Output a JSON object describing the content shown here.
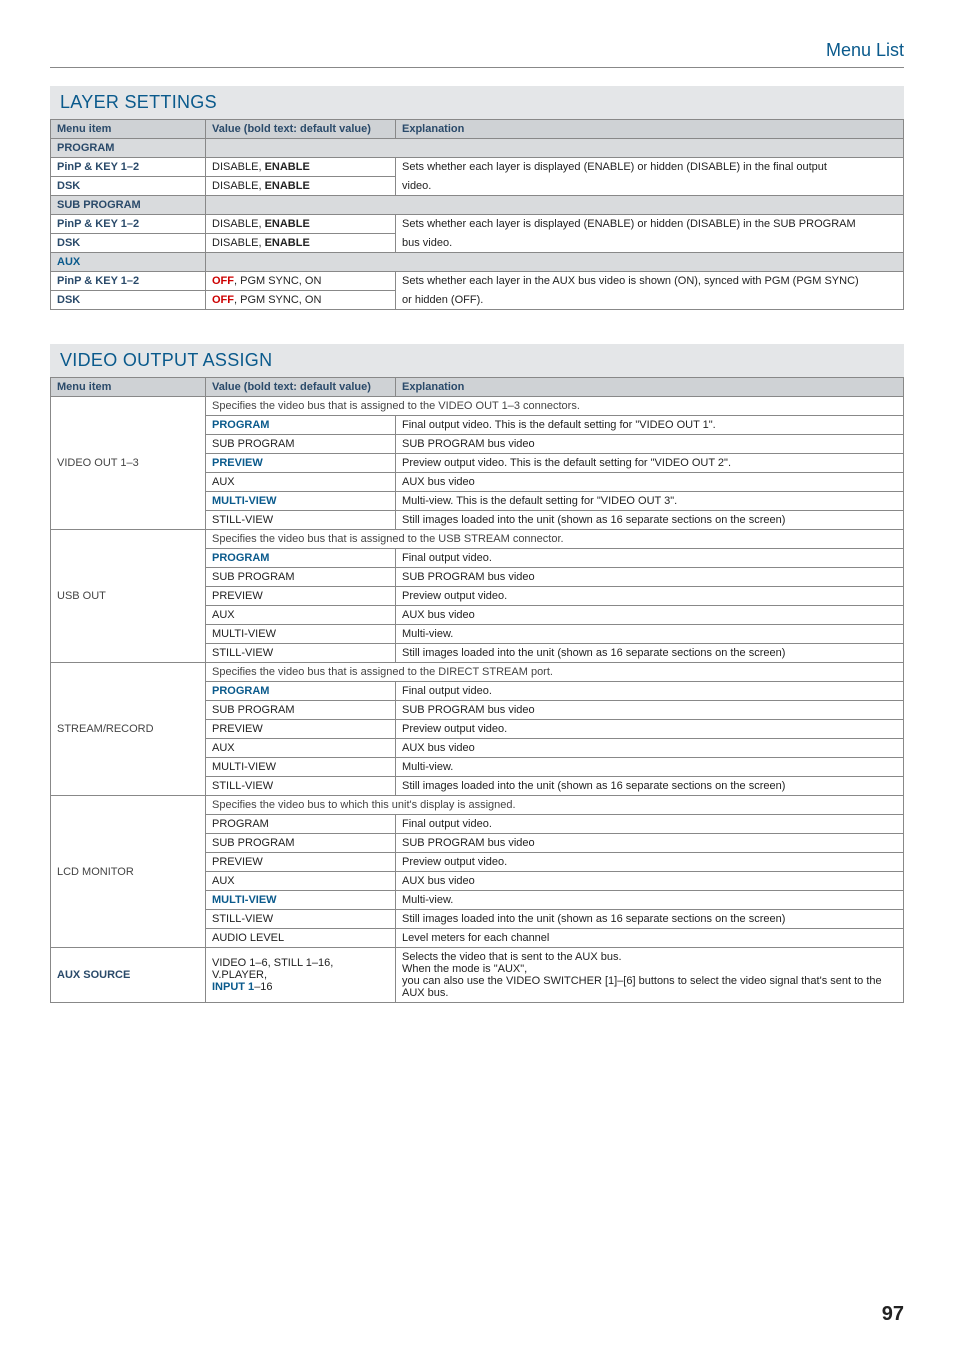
{
  "page_number": "97",
  "breadcrumb": "Menu List",
  "sections": {
    "layer": {
      "title": "LAYER SETTINGS",
      "headers": [
        "Menu item",
        "Value (bold text: default value)",
        "Explanation"
      ],
      "groups": {
        "program": {
          "label": "PROGRAM",
          "pinp_label": "PinP & KEY 1–2",
          "pinp_value_plain": "DISABLE, ",
          "pinp_value_bold": "ENABLE",
          "dsk_label": "DSK",
          "dsk_value_plain": "DISABLE, ",
          "dsk_value_bold": "ENABLE",
          "explain_a": "Sets whether each layer is displayed (ENABLE) or hidden (DISABLE) in the final output",
          "explain_b": "video."
        },
        "subprogram": {
          "label": "SUB PROGRAM",
          "pinp_label": "PinP & KEY 1–2",
          "pinp_value_plain": "DISABLE, ",
          "pinp_value_bold": "ENABLE",
          "dsk_label": "DSK",
          "dsk_value_plain": "DISABLE, ",
          "dsk_value_bold": "ENABLE",
          "explain_a": "Sets whether each layer is displayed (ENABLE) or hidden (DISABLE) in the SUB PROGRAM",
          "explain_b": "bus video."
        },
        "aux": {
          "label": "AUX",
          "pinp_label": "PinP & KEY 1–2",
          "pinp_value_bold": "OFF",
          "pinp_value_plain": ", PGM SYNC, ON",
          "dsk_label": "DSK",
          "dsk_value_bold": "OFF",
          "dsk_value_plain": ", PGM SYNC, ON",
          "explain_a": "Sets whether each layer in the AUX bus video is shown (ON), synced with PGM (PGM SYNC)",
          "explain_b": "or hidden (OFF)."
        }
      }
    },
    "video_assign": {
      "title": "VIDEO OUTPUT ASSIGN",
      "headers": [
        "Menu item",
        "Value (bold text: default value)",
        "Explanation"
      ],
      "video_out": {
        "label": "VIDEO OUT 1–3",
        "spec": "Specifies the video bus that is assigned to the VIDEO OUT 1–3 connectors.",
        "rows": [
          {
            "v": "PROGRAM",
            "vb": true,
            "e": "Final output video. This is the default setting for \"VIDEO OUT 1\"."
          },
          {
            "v": "SUB PROGRAM",
            "vb": false,
            "e": "SUB PROGRAM bus video"
          },
          {
            "v": "PREVIEW",
            "vb": true,
            "e": "Preview output video. This is the default setting for \"VIDEO OUT 2\"."
          },
          {
            "v": "AUX",
            "vb": false,
            "e": "AUX bus video"
          },
          {
            "v": "MULTI-VIEW",
            "vb": true,
            "e": "Multi-view. This is the default setting for \"VIDEO OUT 3\"."
          },
          {
            "v": "STILL-VIEW",
            "vb": false,
            "e": "Still images loaded into the unit (shown as 16 separate sections on the screen)"
          }
        ]
      },
      "usb_out": {
        "label": "USB OUT",
        "spec": "Specifies the video bus that is assigned to the USB STREAM connector.",
        "rows": [
          {
            "v": "PROGRAM",
            "vb": true,
            "e": "Final output video."
          },
          {
            "v": "SUB PROGRAM",
            "vb": false,
            "e": "SUB PROGRAM bus video"
          },
          {
            "v": "PREVIEW",
            "vb": false,
            "e": "Preview output video."
          },
          {
            "v": "AUX",
            "vb": false,
            "e": "AUX bus video"
          },
          {
            "v": "MULTI-VIEW",
            "vb": false,
            "e": "Multi-view."
          },
          {
            "v": "STILL-VIEW",
            "vb": false,
            "e": "Still images loaded into the unit (shown as 16 separate sections on the screen)"
          }
        ]
      },
      "stream_record": {
        "label": "STREAM/RECORD",
        "spec": "Specifies the video bus that is assigned to the DIRECT STREAM port.",
        "rows": [
          {
            "v": "PROGRAM",
            "vb": true,
            "e": "Final output video."
          },
          {
            "v": "SUB PROGRAM",
            "vb": false,
            "e": "SUB PROGRAM bus video"
          },
          {
            "v": "PREVIEW",
            "vb": false,
            "e": "Preview output video."
          },
          {
            "v": "AUX",
            "vb": false,
            "e": "AUX bus video"
          },
          {
            "v": "MULTI-VIEW",
            "vb": false,
            "e": "Multi-view."
          },
          {
            "v": "STILL-VIEW",
            "vb": false,
            "e": "Still images loaded into the unit (shown as 16 separate sections on the screen)"
          }
        ]
      },
      "lcd_monitor": {
        "label": "LCD MONITOR",
        "spec": "Specifies the video bus to which this unit's display is assigned.",
        "rows": [
          {
            "v": "PROGRAM",
            "vb": false,
            "e": "Final output video."
          },
          {
            "v": "SUB PROGRAM",
            "vb": false,
            "e": "SUB PROGRAM bus video"
          },
          {
            "v": "PREVIEW",
            "vb": false,
            "e": "Preview output video."
          },
          {
            "v": "AUX",
            "vb": false,
            "e": "AUX bus video"
          },
          {
            "v": "MULTI-VIEW",
            "vb": true,
            "e": "Multi-view."
          },
          {
            "v": "STILL-VIEW",
            "vb": false,
            "e": "Still images loaded into the unit (shown as 16 separate sections on the screen)"
          },
          {
            "v": "AUDIO LEVEL",
            "vb": false,
            "e": "Level meters for each channel"
          }
        ]
      },
      "aux_source": {
        "label": "AUX SOURCE",
        "value_line1": "VIDEO 1–6, STILL 1–16, V.PLAYER,",
        "value_line2_bold": "INPUT 1",
        "value_line2_plain": "–16",
        "explain_line1": "Selects the video that is sent to the AUX bus.",
        "explain_line2": "When the mode is \"AUX\",",
        "explain_line3": "you can also use the VIDEO SWITCHER [1]–[6] buttons to select the video signal that's sent to the AUX bus."
      }
    }
  }
}
